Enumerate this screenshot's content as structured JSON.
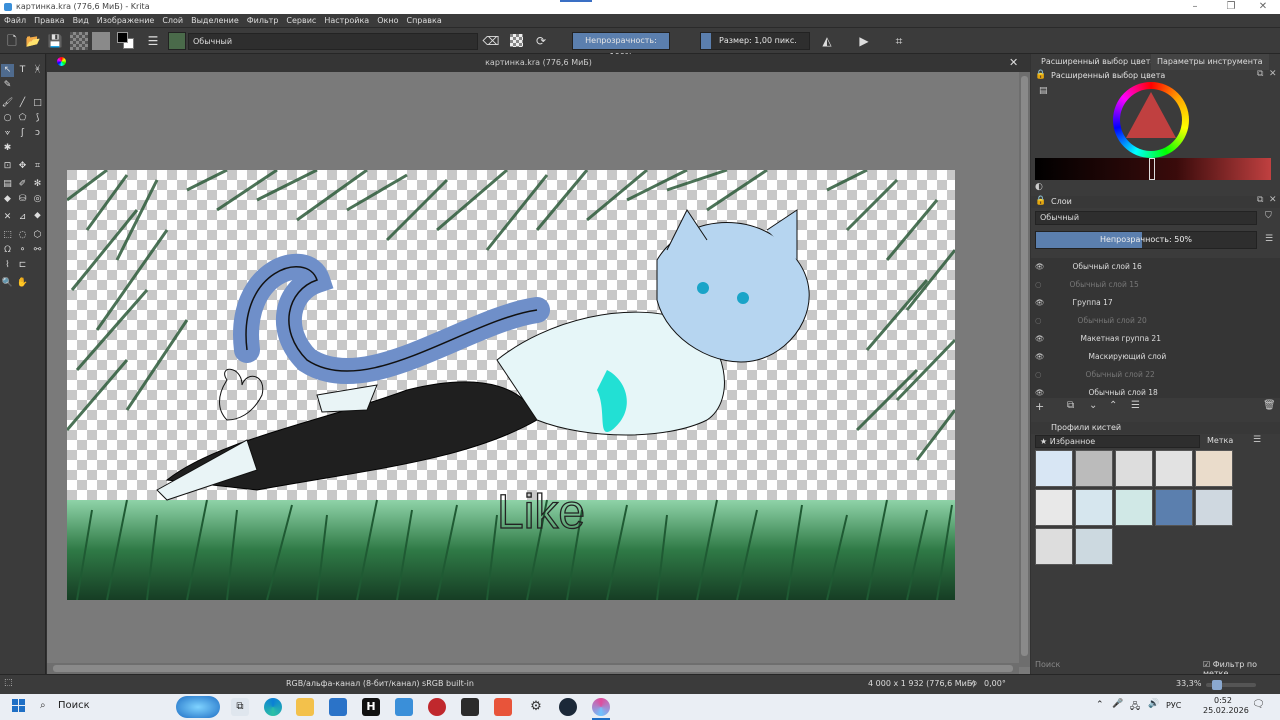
{
  "window": {
    "title": "картинка.kra (776,6 МиБ) - Krita"
  },
  "menu": [
    "Файл",
    "Правка",
    "Вид",
    "Изображение",
    "Слой",
    "Выделение",
    "Фильтр",
    "Сервис",
    "Настройка",
    "Окно",
    "Справка"
  ],
  "toolbar": {
    "blend_mode": "Обычный",
    "opacity": "Непрозрачность: 100%",
    "size": "Размер: 1,00 пикс."
  },
  "document": {
    "tab_title": "картинка.kra (776,6 МиБ)",
    "canvas_text": "Like"
  },
  "dock": {
    "tabs": [
      "Расширенный выбор цвета",
      "Параметры инструмента"
    ],
    "color_panel_title": "Расширенный выбор цвета",
    "layers_title": "Слои",
    "layers_blend": "Обычный",
    "layers_opacity": "Непрозрачность: 50%",
    "layers": [
      {
        "name": "Обычный слой 16",
        "visible": true
      },
      {
        "name": "Обычный слой 15",
        "visible": false
      },
      {
        "name": "Группа 17",
        "visible": true
      },
      {
        "name": "Обычный слой 20",
        "visible": false
      },
      {
        "name": "Макетная группа 21",
        "visible": true
      },
      {
        "name": "Маскирующий слой",
        "visible": true
      },
      {
        "name": "Обычный слой 22",
        "visible": false
      },
      {
        "name": "Обычный слой 18",
        "visible": true
      }
    ],
    "brushes_title": "Профили кистей",
    "brush_preset": "★ Избранное",
    "brush_tag": "Метка",
    "search_placeholder": "Поиск",
    "filter_by_tag": "Фильтр по метке"
  },
  "status": {
    "color_info": "RGB/альфа-канал (8-бит/канал)  sRGB built-in",
    "dimensions": "4 000 x 1 932 (776,6 МиБ)",
    "rotation": "0,00°",
    "zoom": "33,3%"
  },
  "taskbar": {
    "search": "Поиск",
    "lang": "РУС",
    "time": "0:52",
    "date": "25.02.2026"
  },
  "colors": {
    "accent": "#5b7fae",
    "panel": "#3b3b3b",
    "canvas_bg": "#7a7a7a"
  }
}
